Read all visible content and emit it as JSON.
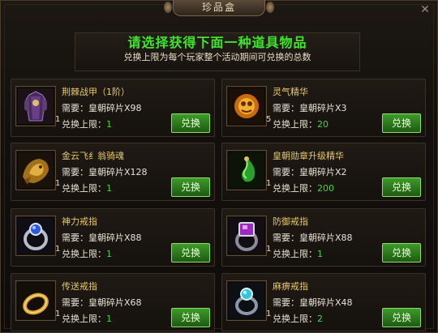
{
  "window": {
    "title": "珍品盒",
    "close_icon": "close-x-icon"
  },
  "header": {
    "headline": "请选择获得下面一种道具物品",
    "subline": "兑换上限为每个玩家整个活动期间可兑换的总数"
  },
  "labels": {
    "need_prefix": "需要：",
    "limit_prefix": "兑换上限："
  },
  "items": [
    {
      "name": "荆棘战甲（1阶）",
      "cost": "皇朝碎片X98",
      "limit": "1",
      "qty": "1",
      "button": "兑换",
      "icon": "armor-icon"
    },
    {
      "name": "灵气精华",
      "cost": "皇朝碎片X3",
      "limit": "20",
      "qty": "5",
      "button": "兑换",
      "icon": "spirit-orb-icon"
    },
    {
      "name": "金云飞纟翁骑魂",
      "cost": "皇朝碎片X128",
      "limit": "1",
      "qty": "1",
      "button": "兑换",
      "icon": "mount-soul-icon"
    },
    {
      "name": "皇朝勋章升级精华",
      "cost": "皇朝碎片X2",
      "limit": "200",
      "qty": "1",
      "button": "兑换",
      "icon": "jade-essence-icon"
    },
    {
      "name": "神力戒指",
      "cost": "皇朝碎片X88",
      "limit": "1",
      "qty": "1",
      "button": "兑换",
      "icon": "blue-ring-icon"
    },
    {
      "name": "防御戒指",
      "cost": "皇朝碎片X88",
      "limit": "1",
      "qty": "1",
      "button": "兑换",
      "icon": "purple-ring-icon"
    },
    {
      "name": "传送戒指",
      "cost": "皇朝碎片X68",
      "limit": "1",
      "qty": "1",
      "button": "兑换",
      "icon": "gold-ring-icon"
    },
    {
      "name": "麻痹戒指",
      "cost": "皇朝碎片X48",
      "limit": "2",
      "qty": "1",
      "button": "兑换",
      "icon": "cyan-ring-icon"
    }
  ]
}
